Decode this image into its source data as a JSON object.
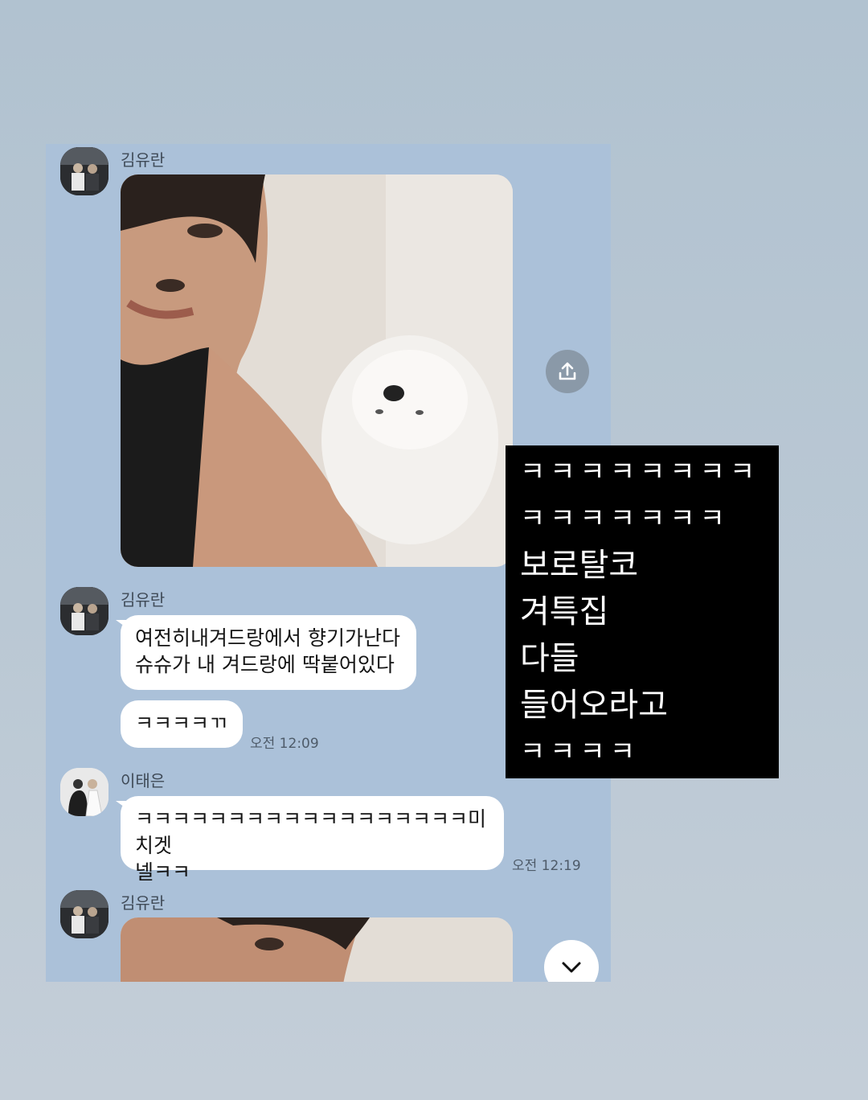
{
  "chat": {
    "messages": [
      {
        "sender": "김유란",
        "type": "photo"
      },
      {
        "sender": "김유란",
        "type": "text",
        "text": "여전히내겨드랑에서 향기가난다\n슈슈가 내 겨드랑에 딱붙어있다"
      },
      {
        "type": "text",
        "text": "ㅋㅋㅋㅋㄲ",
        "time": "오전 12:09"
      },
      {
        "sender": "이태은",
        "type": "text",
        "text": "ㅋㅋㅋㅋㅋㅋㅋㅋㅋㅋㅋㅋㅋㅋㅋㅋㅋㅋ미치겟\n넬ㅋㅋ",
        "time": "오전 12:19"
      },
      {
        "sender": "김유란",
        "type": "photo"
      }
    ]
  },
  "overlay": {
    "lines": [
      "ㅋㅋㅋㅋㅋㅋㅋㅋ",
      "ㅋㅋㅋㅋㅋㅋㅋ",
      "보로탈코",
      "겨특집",
      "다들",
      "들어오라고",
      "ㅋㅋㅋㅋ"
    ]
  },
  "icons": {
    "share": "share-icon",
    "scroll_down": "chevron-down-icon"
  },
  "colors": {
    "chat_background": "#abc1d9",
    "bubble": "#ffffff",
    "overlay": "#000000"
  }
}
